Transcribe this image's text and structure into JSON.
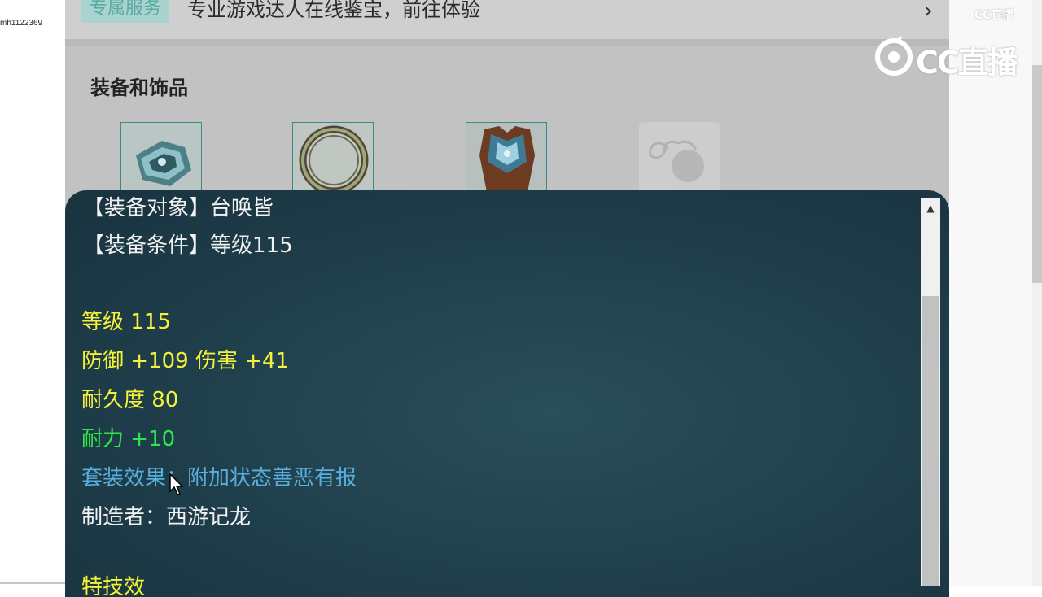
{
  "sidebar": {
    "user_id": "mh1122369"
  },
  "banner": {
    "tag": "专属服务",
    "text": "专业游戏达人在线鉴宝，前往体验",
    "chevron": "›"
  },
  "section": {
    "title": "装备和饰品"
  },
  "equipment": [
    {
      "icon": "bracer-icon"
    },
    {
      "icon": "ring-icon"
    },
    {
      "icon": "armor-icon"
    },
    {
      "icon": "empty-pouch-icon"
    }
  ],
  "tooltip": {
    "equip_target": "【装备对象】台唤皆",
    "equip_condition": "【装备条件】等级115",
    "level": "等级 115",
    "defense_damage": "防御 +109 伤害 +41",
    "durability": "耐久度 80",
    "stamina": "耐力 +10",
    "set_effect": "套装效果：附加状态善恶有报",
    "maker": "制造者：西游记龙",
    "cut_line": "特技效"
  },
  "watermark": {
    "logo_text": "CC直播",
    "small_text": "CC直播"
  },
  "colors": {
    "tooltip_bg": "#1f3e4b",
    "yellow_text": "#f4f23a",
    "green_text": "#2ee84a",
    "blue_text": "#58aedc"
  }
}
